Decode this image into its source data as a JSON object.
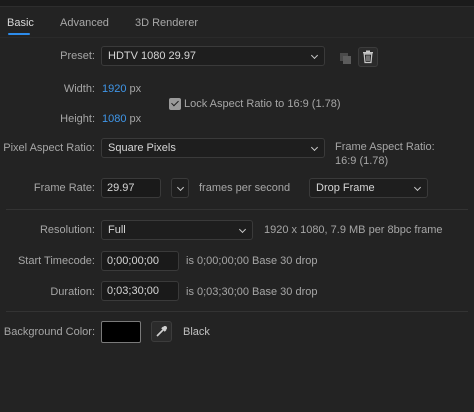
{
  "tabs": [
    {
      "label": "Basic",
      "active": true
    },
    {
      "label": "Advanced",
      "active": false
    },
    {
      "label": "3D Renderer",
      "active": false
    }
  ],
  "preset": {
    "label": "Preset:",
    "value": "HDTV 1080 29.97"
  },
  "width": {
    "label": "Width:",
    "value": "1920",
    "unit": "px"
  },
  "height": {
    "label": "Height:",
    "value": "1080",
    "unit": "px"
  },
  "lock_aspect": {
    "label": "Lock Aspect Ratio to 16:9 (1.78)",
    "checked": true
  },
  "pixel_aspect": {
    "label": "Pixel Aspect Ratio:",
    "value": "Square Pixels",
    "frame_aspect_label": "Frame Aspect Ratio:",
    "frame_aspect_value": "16:9 (1.78)"
  },
  "frame_rate": {
    "label": "Frame Rate:",
    "value": "29.97",
    "unit_label": "frames per second",
    "drop_frame": "Drop Frame"
  },
  "resolution": {
    "label": "Resolution:",
    "value": "Full",
    "info": "1920 x 1080, 7.9 MB per 8bpc frame"
  },
  "start_timecode": {
    "label": "Start Timecode:",
    "value": "0;00;00;00",
    "info": "is 0;00;00;00  Base 30  drop"
  },
  "duration": {
    "label": "Duration:",
    "value": "0;03;30;00",
    "info": "is 0;03;30;00  Base 30  drop"
  },
  "background": {
    "label": "Background Color:",
    "color": "#000000",
    "color_name": "Black"
  },
  "icons": {
    "save_preset": "save-preset-icon",
    "delete_preset": "trash-icon",
    "eyedropper": "eyedropper-icon"
  },
  "colors": {
    "accent": "#3f96e8",
    "panel": "#232323"
  }
}
